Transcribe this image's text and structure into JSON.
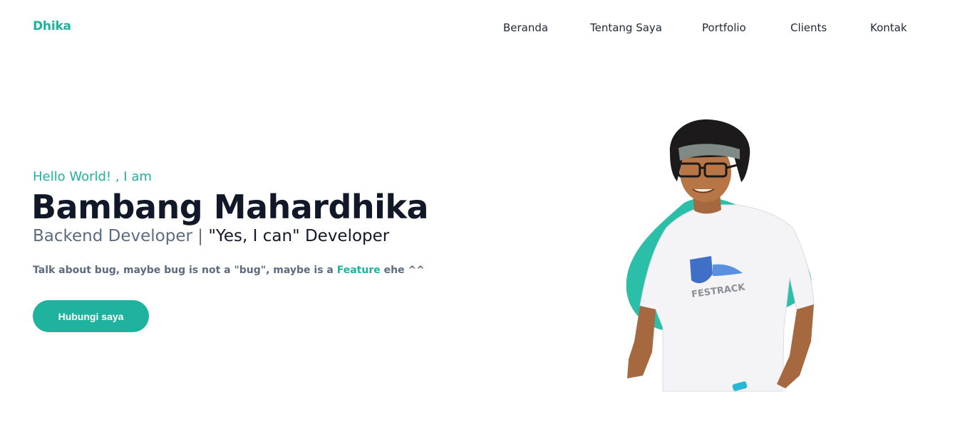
{
  "brand": "Dhika",
  "nav": {
    "items": [
      {
        "label": "Beranda"
      },
      {
        "label": "Tentang Saya"
      },
      {
        "label": "Portfolio"
      },
      {
        "label": "Clients"
      },
      {
        "label": "Kontak"
      }
    ]
  },
  "hero": {
    "greeting": "Hello World! , I am",
    "name": "Bambang Mahardhika",
    "role_primary": "Backend Developer |",
    "role_secondary": "\"Yes, I can\" Developer",
    "tagline_before": "Talk about bug, maybe bug is not a \"bug\", maybe is a",
    "tagline_highlight": "Feature",
    "tagline_after": "ehe ^^",
    "cta_label": "Hubungi saya"
  },
  "shirt_print": "FESTRACK",
  "colors": {
    "accent": "#1fb29e",
    "heading": "#111827",
    "muted": "#5b6b80"
  }
}
